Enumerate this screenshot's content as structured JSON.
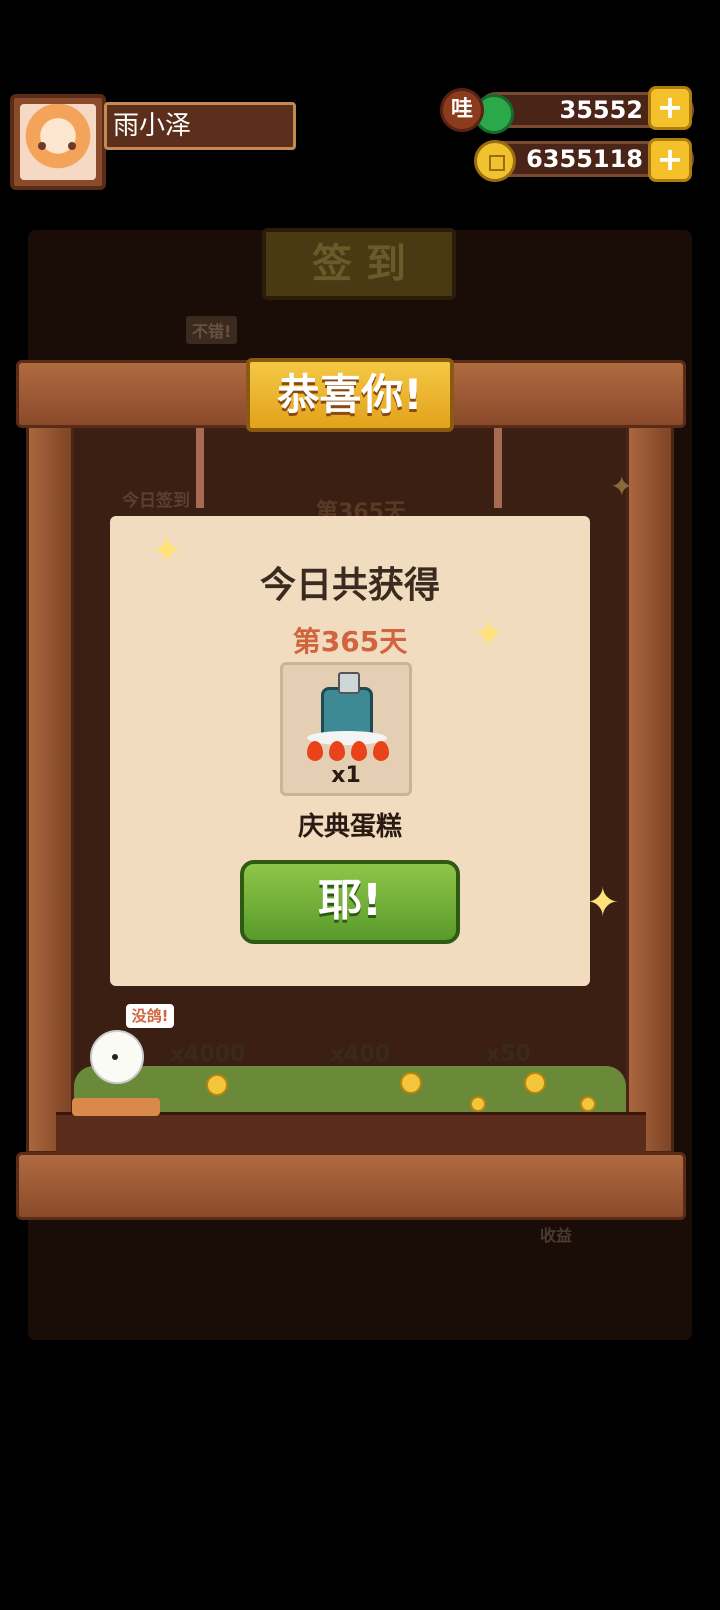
{
  "player": {
    "name": "雨小泽"
  },
  "resources": {
    "badge_label": "哇",
    "jade": "35552",
    "coins": "6355118",
    "plus": "+"
  },
  "background": {
    "title": "签 到",
    "speech": "不错!",
    "today_label": "今日签到",
    "day_label": "第365天",
    "reward_counts": [
      "x4000",
      "x400",
      "x50"
    ],
    "side_label": "收益"
  },
  "modal": {
    "banner": "恭喜你!",
    "heading": "今日共获得",
    "day": "第365天",
    "reward": {
      "icon": "celebration-cake-icon",
      "quantity": "x1",
      "name": "庆典蛋糕"
    },
    "confirm": "耶!"
  },
  "chick": {
    "speech": "没鸽!"
  },
  "colors": {
    "accent_green": "#6aae36",
    "title_gold": "#f0b72f",
    "day_red": "#d0643c"
  }
}
